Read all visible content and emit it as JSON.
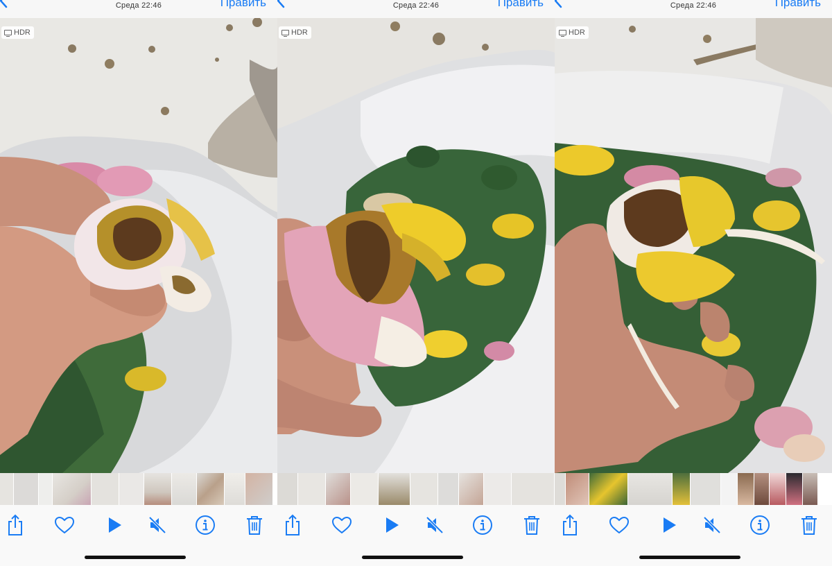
{
  "screens": [
    {
      "nav": {
        "title": "Среда  22:46",
        "edit_label": "Править"
      },
      "hdr_label": "HDR",
      "toolbar": {
        "icons": [
          "share-icon",
          "heart-icon",
          "play-icon",
          "mute-icon",
          "info-icon",
          "trash-icon"
        ]
      }
    },
    {
      "nav": {
        "title": "Среда  22:46",
        "edit_label": "Править"
      },
      "hdr_label": "HDR",
      "toolbar": {
        "icons": [
          "share-icon",
          "heart-icon",
          "play-icon",
          "mute-icon",
          "info-icon",
          "trash-icon"
        ]
      }
    },
    {
      "nav": {
        "title": "Среда  22:46",
        "edit_label": "Править"
      },
      "hdr_label": "HDR",
      "toolbar": {
        "icons": [
          "share-icon",
          "heart-icon",
          "play-icon",
          "mute-icon",
          "info-icon",
          "trash-icon"
        ]
      }
    }
  ],
  "colors": {
    "accent": "#1a7cf4",
    "toolbar_bg": "#f9f9f9",
    "home_indicator": "#111111"
  }
}
